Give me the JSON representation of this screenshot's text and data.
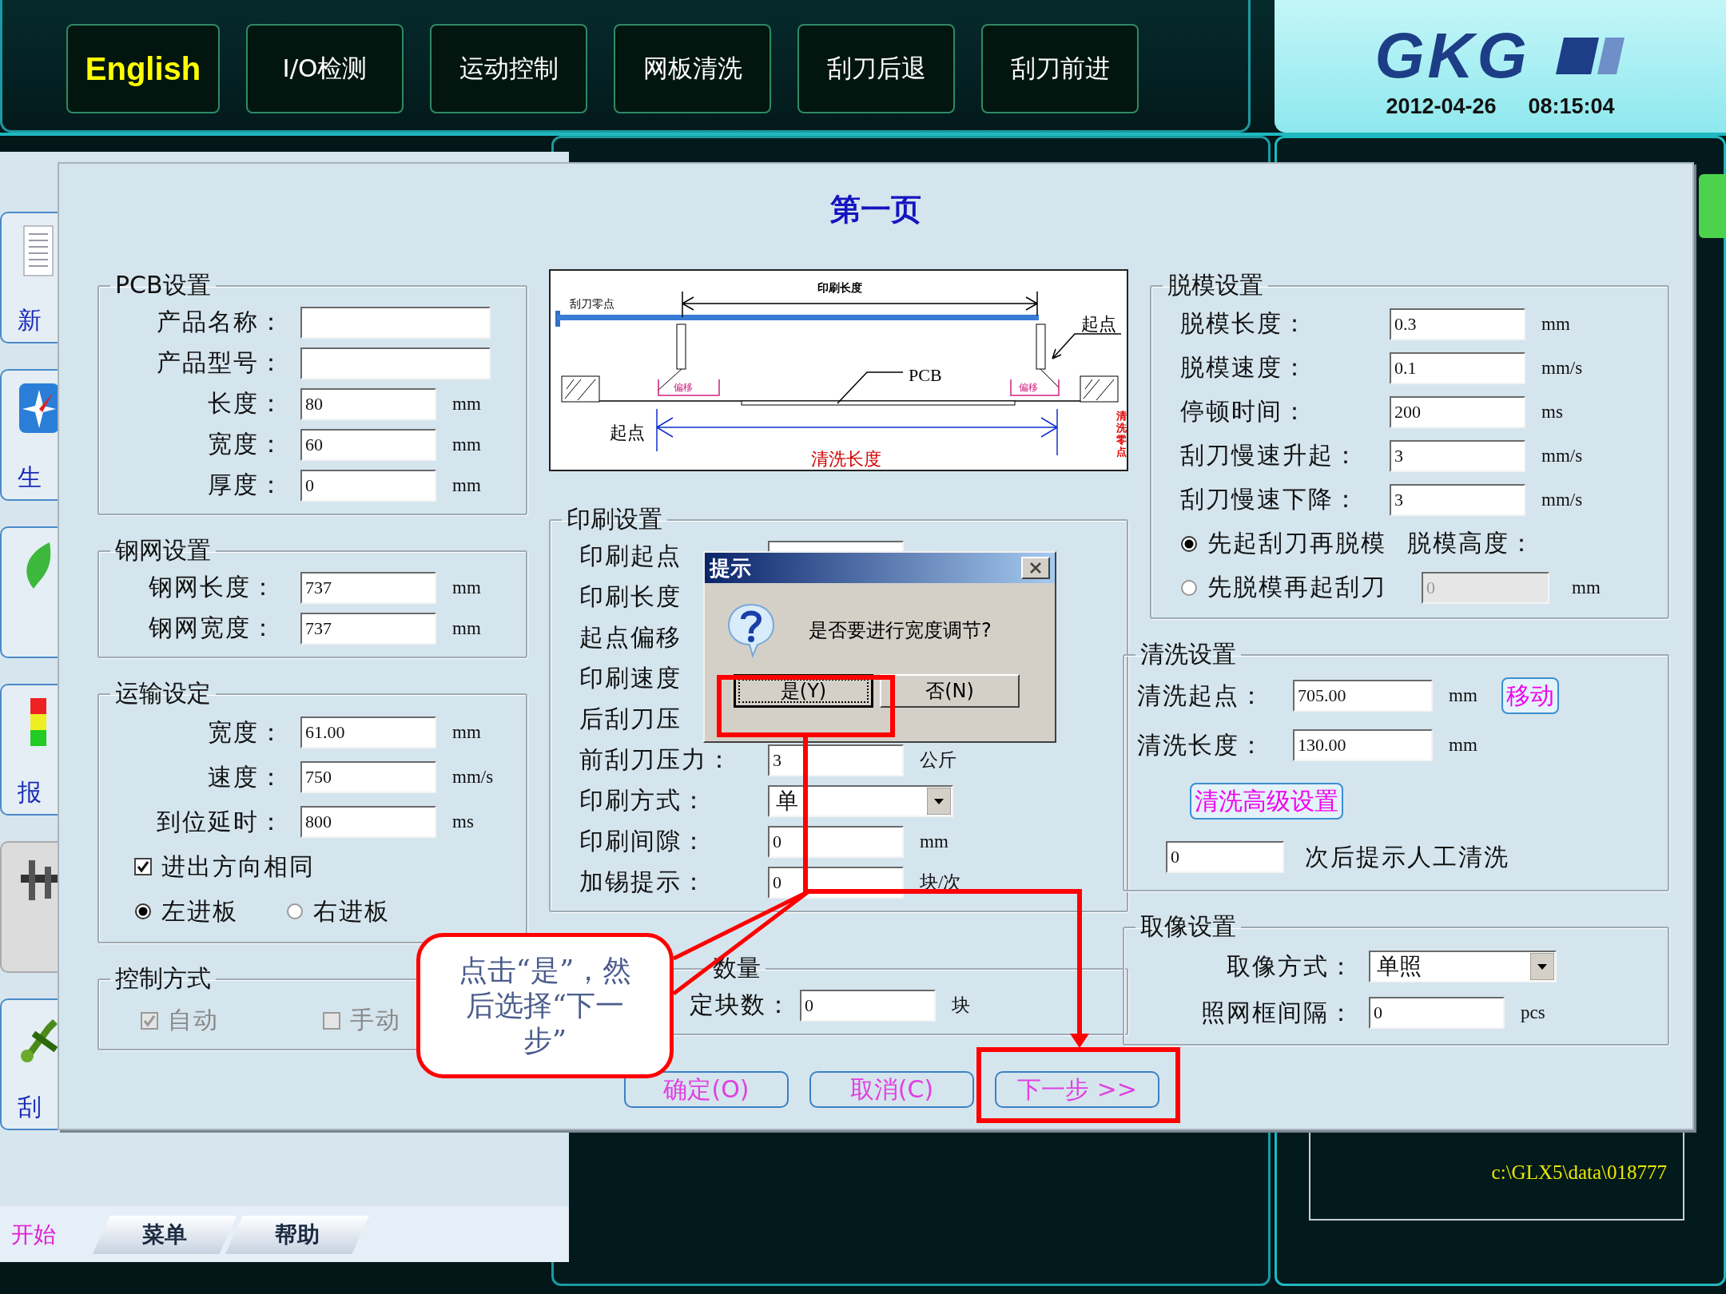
{
  "top_nav": [
    {
      "kind": "language",
      "label": "English"
    },
    {
      "kind": "command",
      "label": "I/O检测"
    },
    {
      "kind": "command",
      "label": "运动控制"
    },
    {
      "kind": "command",
      "label": "网板清洗"
    },
    {
      "kind": "command",
      "label": "刮刀后退"
    },
    {
      "kind": "command",
      "label": "刮刀前进"
    }
  ],
  "logo": {
    "text": "GKG",
    "date": "2012-04-26",
    "time": "08:15:04"
  },
  "sidebar": {
    "items": [
      {
        "kind": "document",
        "label": "新",
        "disabled": false
      },
      {
        "kind": "compass",
        "label": "生",
        "disabled": false
      },
      {
        "kind": "leaf",
        "disabled": false
      },
      {
        "kind": "signal-light",
        "label": "报",
        "disabled": false
      },
      {
        "kind": "caliper",
        "disabled": true
      },
      {
        "kind": "wrench",
        "label": "刮",
        "disabled": false
      }
    ]
  },
  "bottom_tabs": [
    {
      "label": "开始",
      "selected": true
    },
    {
      "label": "菜单",
      "selected": false
    },
    {
      "label": "帮助",
      "selected": false
    }
  ],
  "file_panel": {
    "path": "c:\\GLX5\\data\\018777"
  },
  "main_window": {
    "title": "第一页",
    "columns": [
      [
        {
          "kind": "group",
          "title": "PCB设置",
          "rows": [
            {
              "kind": "input",
              "label": "产品名称："
            },
            {
              "kind": "input",
              "label": "产品型号："
            },
            {
              "kind": "input",
              "label": "长度：",
              "value": "80",
              "unit": "mm"
            },
            {
              "kind": "input",
              "label": "宽度：",
              "value": "60",
              "unit": "mm"
            },
            {
              "kind": "input",
              "label": "厚度：",
              "value": "0",
              "unit": "mm"
            }
          ]
        },
        {
          "kind": "group",
          "title": "钢网设置",
          "rows": [
            {
              "kind": "input",
              "label": "钢网长度：",
              "value": "737",
              "unit": "mm"
            },
            {
              "kind": "input",
              "label": "钢网宽度：",
              "value": "737",
              "unit": "mm"
            }
          ]
        },
        {
          "kind": "group",
          "title": "运输设定",
          "rows": [
            {
              "kind": "input",
              "label": "宽度：",
              "value": "61.00",
              "unit": "mm"
            },
            {
              "kind": "input",
              "label": "速度：",
              "value": "750",
              "unit": "mm/s"
            },
            {
              "kind": "input",
              "label": "到位延时：",
              "value": "800",
              "unit": "ms"
            },
            {
              "kind": "checks",
              "items": [
                {
                  "label": "进出方向相同",
                  "checked": true,
                  "disabled": false
                }
              ]
            },
            {
              "kind": "radios",
              "options": [
                {
                  "label": "左进板",
                  "selected": true
                },
                {
                  "label": "右进板",
                  "selected": false
                }
              ]
            }
          ]
        },
        {
          "kind": "group",
          "title": "控制方式",
          "rows": [
            {
              "kind": "checks",
              "items": [
                {
                  "label": "自动",
                  "checked": true,
                  "disabled": true
                },
                {
                  "label": "手动",
                  "checked": false,
                  "disabled": true
                }
              ]
            }
          ]
        }
      ],
      [
        {
          "kind": "diagram",
          "labels": {
            "print_length": "印刷长度",
            "squeegee_zero": "刮刀零点",
            "start_top": "起点",
            "pcb": "PCB",
            "offset_left": "偏移",
            "offset_right": "偏移",
            "start_bottom": "起点",
            "clean_length": "清洗长度",
            "clean_zero": "清洗零点"
          }
        },
        {
          "kind": "group",
          "title": "印刷设置",
          "rows": [
            {
              "kind": "input",
              "label": "印刷起点"
            },
            {
              "kind": "input",
              "label": "印刷长度"
            },
            {
              "kind": "input",
              "label": "起点偏移"
            },
            {
              "kind": "input",
              "label": "印刷速度"
            },
            {
              "kind": "input",
              "label": "后刮刀压"
            },
            {
              "kind": "input",
              "label": "前刮刀压力：",
              "value": "3",
              "unit": "公斤"
            },
            {
              "kind": "select",
              "label": "印刷方式：",
              "value": "单"
            },
            {
              "kind": "input",
              "label": "印刷间隙：",
              "value": "0",
              "unit": "mm"
            },
            {
              "kind": "input",
              "label": "加锡提示：",
              "value": "0",
              "unit": "块/次"
            }
          ]
        },
        {
          "kind": "group",
          "title": "数量",
          "rows": [
            {
              "kind": "input",
              "label": "定块数：",
              "value": "0",
              "unit": "块"
            }
          ]
        }
      ],
      [
        {
          "kind": "group",
          "title": "脱模设置",
          "rows": [
            {
              "kind": "input",
              "label": "脱模长度：",
              "value": "0.3",
              "unit": "mm"
            },
            {
              "kind": "input",
              "label": "脱模速度：",
              "value": "0.1",
              "unit": "mm/s"
            },
            {
              "kind": "input",
              "label": "停顿时间：",
              "value": "200",
              "unit": "ms"
            },
            {
              "kind": "input",
              "label": "刮刀慢速升起：",
              "value": "3",
              "unit": "mm/s"
            },
            {
              "kind": "input",
              "label": "刮刀慢速下降：",
              "value": "3",
              "unit": "mm/s"
            },
            {
              "kind": "radio",
              "label": "先起刮刀再脱模",
              "selected": true,
              "note": "脱模高度："
            },
            {
              "kind": "radio",
              "label": "先脱模再起刮刀",
              "selected": false,
              "value": "0",
              "unit": "mm",
              "disabled": true
            }
          ]
        },
        {
          "kind": "group",
          "title": "清洗设置",
          "rows": [
            {
              "kind": "input",
              "label": "清洗起点：",
              "value": "705.00",
              "unit": "mm",
              "button": "移动"
            },
            {
              "kind": "input",
              "label": "清洗长度：",
              "value": "130.00",
              "unit": "mm"
            },
            {
              "kind": "button",
              "label": "清洗高级设置"
            },
            {
              "kind": "input",
              "value": "0",
              "unit": "次后提示人工清洗"
            }
          ]
        },
        {
          "kind": "group",
          "title": "取像设置",
          "rows": [
            {
              "kind": "select",
              "label": "取像方式：",
              "value": "单照"
            },
            {
              "kind": "input",
              "label": "照网框间隔：",
              "value": "0",
              "unit": "pcs"
            }
          ]
        }
      ]
    ],
    "buttons": [
      "确定(O)",
      "取消(C)",
      "下一步 >>"
    ]
  },
  "prompt": {
    "title": "提示",
    "message": "是否要进行宽度调节?",
    "buttons": [
      {
        "label": "是(Y)",
        "focused": true
      },
      {
        "label": "否(N)",
        "focused": false
      }
    ]
  },
  "annotation": {
    "callout": "点击“是”，然后选择“下一步”"
  }
}
